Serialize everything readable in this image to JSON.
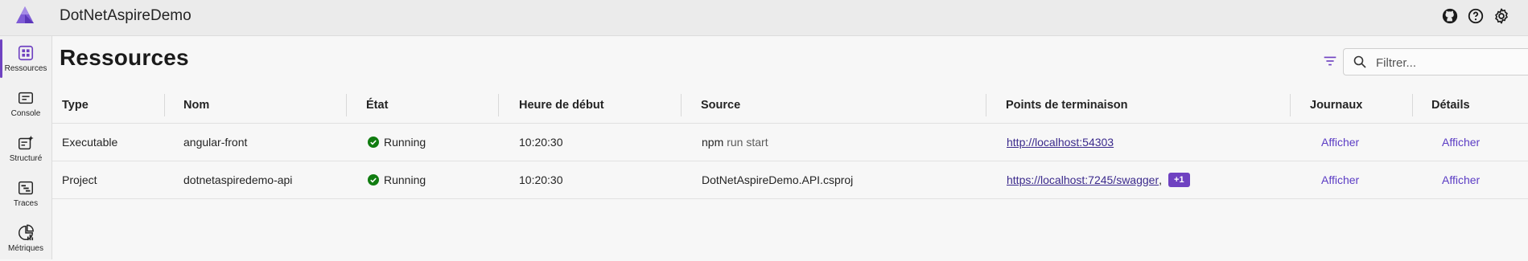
{
  "app": {
    "title": "DotNetAspireDemo"
  },
  "sidebar": {
    "items": [
      {
        "label": "Ressources",
        "icon": "resources-icon",
        "active": true
      },
      {
        "label": "Console",
        "icon": "console-icon"
      },
      {
        "label": "Structuré",
        "icon": "structured-logs-icon"
      },
      {
        "label": "Traces",
        "icon": "traces-icon"
      },
      {
        "label": "Métriques",
        "icon": "metrics-icon"
      }
    ]
  },
  "main": {
    "title": "Ressources",
    "search": {
      "placeholder": "Filtrer...",
      "value": ""
    }
  },
  "table": {
    "columns": [
      "Type",
      "Nom",
      "État",
      "Heure de début",
      "Source",
      "Points de terminaison",
      "Journaux",
      "Détails"
    ],
    "rows": [
      {
        "type": "Executable",
        "name": "angular-front",
        "state": "Running",
        "start": "10:20:30",
        "source_main": "npm",
        "source_args": "run start",
        "endpoint": "http://localhost:54303",
        "endpoint_extra": "",
        "logs": "Afficher",
        "details": "Afficher"
      },
      {
        "type": "Project",
        "name": "dotnetaspiredemo-api",
        "state": "Running",
        "start": "10:20:30",
        "source_main": "DotNetAspireDemo.API.csproj",
        "source_args": "",
        "endpoint": "https://localhost:7245/swagger",
        "endpoint_sep": ",",
        "endpoint_extra": "+1",
        "logs": "Afficher",
        "details": "Afficher"
      }
    ]
  },
  "colors": {
    "accent": "#6f42c1",
    "running": "#107c10",
    "link": "#3b2a8c"
  }
}
